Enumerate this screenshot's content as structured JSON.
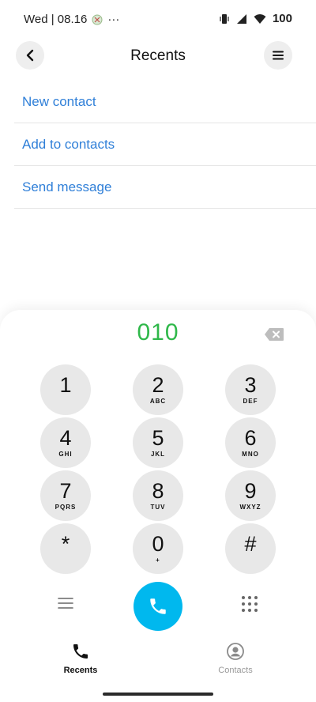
{
  "status_bar": {
    "time": "Wed | 08.16",
    "more": "···",
    "battery": "100"
  },
  "header": {
    "title": "Recents",
    "back_icon": "chevron-left-icon",
    "menu_icon": "hamburger-icon"
  },
  "actions": [
    {
      "label": "New contact"
    },
    {
      "label": "Add to contacts"
    },
    {
      "label": "Send message"
    }
  ],
  "dialer": {
    "number": "010",
    "keys": [
      {
        "digit": "1",
        "letters": ""
      },
      {
        "digit": "2",
        "letters": "ABC"
      },
      {
        "digit": "3",
        "letters": "DEF"
      },
      {
        "digit": "4",
        "letters": "GHI"
      },
      {
        "digit": "5",
        "letters": "JKL"
      },
      {
        "digit": "6",
        "letters": "MNO"
      },
      {
        "digit": "7",
        "letters": "PQRS"
      },
      {
        "digit": "8",
        "letters": "TUV"
      },
      {
        "digit": "9",
        "letters": "WXYZ"
      },
      {
        "digit": "*",
        "letters": ""
      },
      {
        "digit": "0",
        "letters": "+"
      },
      {
        "digit": "#",
        "letters": ""
      }
    ],
    "call_color": "#00b8ee",
    "number_color": "#2fb84a"
  },
  "nav": {
    "recents_label": "Recents",
    "contacts_label": "Contacts"
  },
  "colors": {
    "accent_link": "#2f7fd8"
  }
}
